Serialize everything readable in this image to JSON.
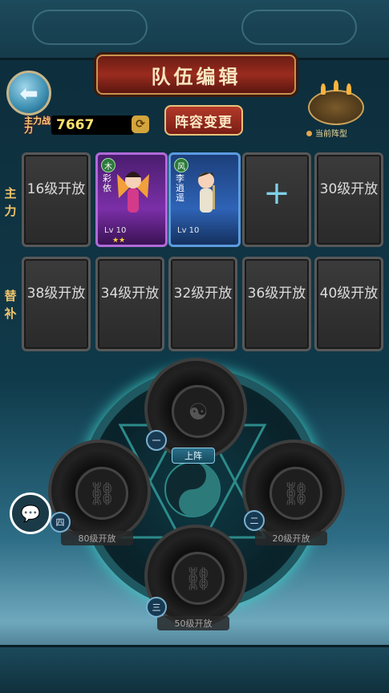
{
  "header": {
    "title": "队伍编辑",
    "back_icon": "back-arrow-icon"
  },
  "power": {
    "label": "主力战力",
    "value": "7667"
  },
  "change_button": "阵容变更",
  "formation": {
    "label": "当前阵型"
  },
  "rows": {
    "main_label": "主力",
    "sub_label": "替补"
  },
  "main_slots": [
    {
      "type": "locked",
      "text": "16级开放"
    },
    {
      "type": "hero",
      "name": "彩依",
      "element": "木",
      "level": "Lv 10",
      "stars": "★★",
      "rarity": "purple"
    },
    {
      "type": "hero",
      "name": "李逍遥",
      "element": "风",
      "level": "Lv 10",
      "stars": "",
      "rarity": "blue"
    },
    {
      "type": "add",
      "text": "+"
    },
    {
      "type": "locked",
      "text": "30级开放"
    }
  ],
  "sub_slots": [
    {
      "type": "locked",
      "text": "38级开放"
    },
    {
      "type": "locked",
      "text": "34级开放"
    },
    {
      "type": "locked",
      "text": "32级开放"
    },
    {
      "type": "locked",
      "text": "36级开放"
    },
    {
      "type": "locked",
      "text": "40级开放"
    }
  ],
  "formation_seats": {
    "top": {
      "label": "上阵",
      "number": "一"
    },
    "left": {
      "label": "80级开放",
      "number": "四"
    },
    "right": {
      "label": "20级开放",
      "number": "二"
    },
    "bottom": {
      "label": "50级开放",
      "number": "三"
    }
  },
  "chat_icon": "chat-bubble-icon",
  "colors": {
    "accent_gold": "#f1c46a",
    "purple_rarity": "#b06ad8",
    "blue_rarity": "#5c9ae0"
  }
}
